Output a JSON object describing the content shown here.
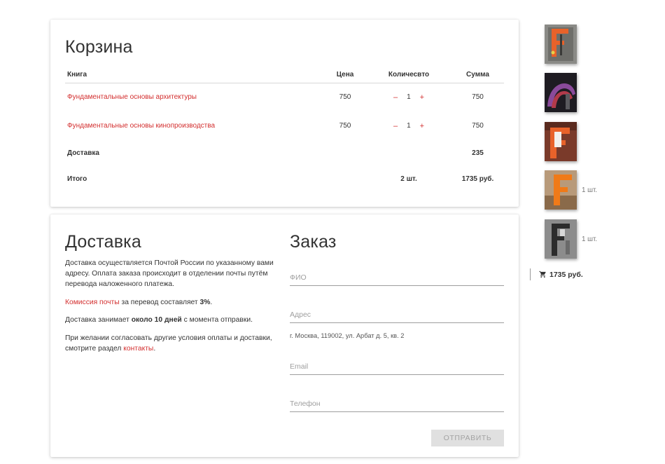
{
  "cart": {
    "title": "Корзина",
    "headers": {
      "book": "Книга",
      "price": "Цена",
      "qty": "Количесвто",
      "sum": "Сумма"
    },
    "items": [
      {
        "title": "Фундаментальные основы архитектуры",
        "price": "750",
        "qty": "1",
        "sum": "750"
      },
      {
        "title": "Фундаментальные основы кинопроизводства",
        "price": "750",
        "qty": "1",
        "sum": "750"
      }
    ],
    "qty_minus": "–",
    "qty_plus": "+",
    "shipping": {
      "label": "Доставка",
      "sum": "235"
    },
    "total": {
      "label": "Итого",
      "qty": "2 шт.",
      "sum": "1735 руб."
    }
  },
  "delivery": {
    "title": "Доставка",
    "p1": "Доставка осуществляется Почтой России по указанному вами адресу. Оплата заказа происходит в отделении почты путём перевода наложенного платежа.",
    "p2_link": "Комиссия почты",
    "p2_mid": " за перевод составляет ",
    "p2_bold": "3%",
    "p2_end": ".",
    "p3_start": "Доставка занимает ",
    "p3_bold": "около 10 дней",
    "p3_end": " с момента отправки.",
    "p4_start": "При желании согласовать другие условия оплаты и доставки, смотрите раздел ",
    "p4_link": "контакты",
    "p4_end": "."
  },
  "order": {
    "title": "Заказ",
    "fio_placeholder": "ФИО",
    "address_placeholder": "Адрес",
    "address_hint": "г. Москва, 119002, ул. Арбат д. 5, кв. 2",
    "email_placeholder": "Email",
    "phone_placeholder": "Телефон",
    "submit_label": "ОТПРАВИТЬ"
  },
  "sidebar": {
    "thumbs": [
      {
        "count": ""
      },
      {
        "count": ""
      },
      {
        "count": ""
      },
      {
        "count": "1 шт."
      },
      {
        "count": "1 шт."
      }
    ],
    "mini_cart_total": "1735 руб."
  },
  "colors": {
    "accent": "#d32f2f",
    "orange": "#e8622a",
    "button_bg": "#e0e0e0"
  }
}
